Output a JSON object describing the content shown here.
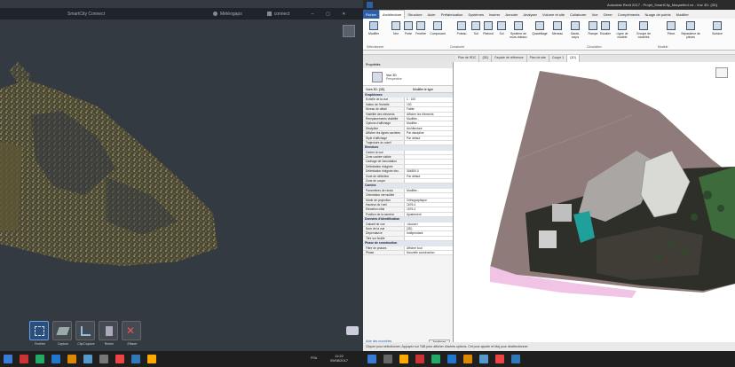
{
  "left_app": {
    "title": "SmartCity Connect",
    "user_label": "Météogaps",
    "connect_label": "connect",
    "tools": [
      {
        "label": "Fenêtre",
        "selected": true
      },
      {
        "label": "Capture",
        "selected": false
      },
      {
        "label": "Clip/Capture",
        "selected": false
      },
      {
        "label": "Retirer",
        "selected": false
      },
      {
        "label": "Effacer",
        "selected": false
      }
    ]
  },
  "revit": {
    "title": "Autodesk Revit 2017 - Projet_SmartCity_Maquette4.rvt - Vue 3D: {3D}",
    "tabs": [
      "Fichier",
      "Architecture",
      "Structure",
      "Acier",
      "Préfabrication",
      "Systèmes",
      "Insérer",
      "Annoter",
      "Analyser",
      "Volume et site",
      "Collaborer",
      "Vue",
      "Gérer",
      "Compléments",
      "Nuage de points",
      "Modifier"
    ],
    "ribbon_buttons": [
      "Modifier",
      "Mur",
      "Porte",
      "Fenêtre",
      "Composant",
      "Poteau",
      "Toit",
      "Plafond",
      "Sol",
      "Système de murs-rideaux",
      "Quadrillage",
      "Meneau",
      "Garde-corps",
      "Rampe",
      "Escalier",
      "Ligne de modèle",
      "Groupe de modèles",
      "Pièce",
      "Séparateur de pièces",
      "Surface"
    ],
    "panel_labels": [
      "Sélectionner",
      "Construire",
      "Circulation",
      "Modèle"
    ],
    "doc_tabs": [
      "Plan de RDC",
      "{3D}",
      "Façade de référence",
      "Plan de site",
      "Coupe 1",
      "{3D}"
    ],
    "properties_title": "Propriétés",
    "type_name": "Vue 3D",
    "type_sub": "Perspective",
    "view_selector": "Vues 3D: {3D}",
    "edit_type": "Modifier le type",
    "sections": [
      {
        "name": "Graphismes",
        "rows": [
          [
            "Echelle de la vue",
            "1 : 100"
          ],
          [
            "Valeur de l'échelle",
            "100"
          ],
          [
            "Niveau de détail",
            "Faible"
          ],
          [
            "Visibilité des éléments",
            "Afficher les éléments"
          ],
          [
            "Remplacements visibilité",
            "Modifier..."
          ],
          [
            "Options d'affichage",
            "Modifier..."
          ],
          [
            "Discipline",
            "Architecture"
          ],
          [
            "Afficher les lignes cachées",
            "Par discipline"
          ],
          [
            "Style d'affichage",
            "Par défaut"
          ],
          [
            "Trajectoire du soleil",
            ""
          ]
        ]
      },
      {
        "name": "Etendues",
        "rows": [
          [
            "Cadrer la vue",
            ""
          ],
          [
            "Zone cadrée visible",
            ""
          ],
          [
            "Cadrage de l'annotation",
            ""
          ],
          [
            "Délimitation éloignée",
            ""
          ],
          [
            "Délimitation éloignée dec.",
            "304800.0"
          ],
          [
            "Zone de définition",
            "Par défaut"
          ],
          [
            "Zone de coupe",
            ""
          ]
        ]
      },
      {
        "name": "Caméra",
        "rows": [
          [
            "Paramètres de rendu",
            "Modifier..."
          ],
          [
            "Orientation verrouillée",
            ""
          ],
          [
            "Mode de projection",
            "Orthographique"
          ],
          [
            "Hauteur de l'oeil",
            "1676.4"
          ],
          [
            "Elévation cible",
            "1676.4"
          ],
          [
            "Position de la caméra",
            "Ajustement"
          ]
        ]
      },
      {
        "name": "Données d'identification",
        "rows": [
          [
            "Gabarit de vue",
            "<Aucun>"
          ],
          [
            "Nom de la vue",
            "{3D}"
          ],
          [
            "Dépendance",
            "Indépendant"
          ],
          [
            "Titre sur feuille",
            ""
          ]
        ]
      },
      {
        "name": "Phase de construction",
        "rows": [
          [
            "Filtre de phases",
            "Afficher tout"
          ],
          [
            "Phase",
            "Nouvelle construction"
          ]
        ]
      }
    ],
    "help_link": "Aide des propriétés",
    "apply_button": "Appliquer",
    "status_text": "Cliquer pour sélectionner, Appuyez sur TAB pour afficher d'autres options, Ctrl pour ajouter et Maj pour désélectionner.",
    "view_cube_label": "Accueil"
  },
  "taskbar": {
    "time": "11:22",
    "date": "09/08/2017",
    "keyboard": "FRA"
  },
  "colors": {
    "pointcloud_bg": "#333a42",
    "revit_blue": "#2c5fa8",
    "terrain": "#8e7b7a",
    "pink_pad": "#f1c4e6"
  }
}
